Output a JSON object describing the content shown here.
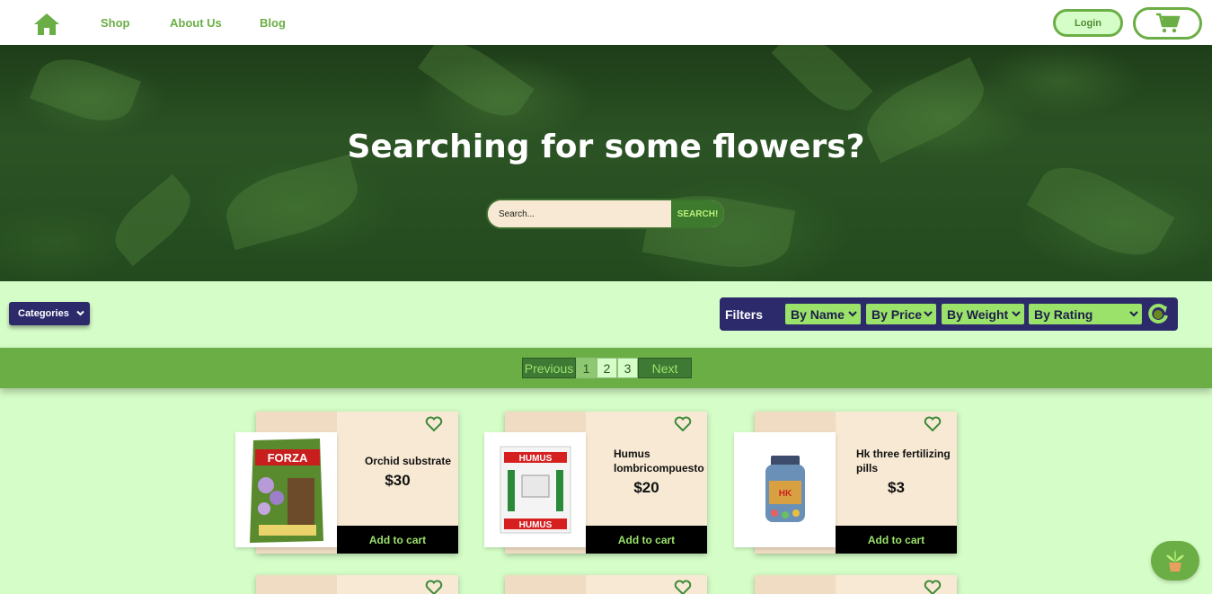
{
  "nav": {
    "links": [
      "Shop",
      "About Us",
      "Blog"
    ],
    "login_label": "Login"
  },
  "hero": {
    "title": "Searching for some flowers?",
    "search_placeholder": "Search...",
    "search_button": "SEARCH!"
  },
  "filters": {
    "categories_label": "Categories",
    "label": "Filters",
    "selects": [
      "By Name",
      "By Price",
      "By Weight",
      "By Rating"
    ]
  },
  "pagination": {
    "previous": "Previous",
    "pages": [
      "1",
      "2",
      "3"
    ],
    "current_page": "1",
    "next": "Next"
  },
  "products": [
    {
      "name": "Orchid substrate",
      "price": "$30",
      "cart_label": "Add to cart",
      "image": "forza-bag"
    },
    {
      "name": "Humus lombricompuesto",
      "price": "$20",
      "cart_label": "Add to cart",
      "image": "humus-bag"
    },
    {
      "name": "Hk three fertilizing pills",
      "price": "$3",
      "cart_label": "Add to cart",
      "image": "pill-jar"
    }
  ],
  "colors": {
    "accent_green": "#6bae45",
    "light_green_bg": "#d5fdc7",
    "navy": "#2c2a6b",
    "card_bg": "#f7e9d3",
    "select_green": "#9ae26a"
  },
  "icons": [
    "home-icon",
    "cart-icon",
    "chevron-down-icon",
    "refresh-icon",
    "heart-icon",
    "plant-pot-icon"
  ]
}
